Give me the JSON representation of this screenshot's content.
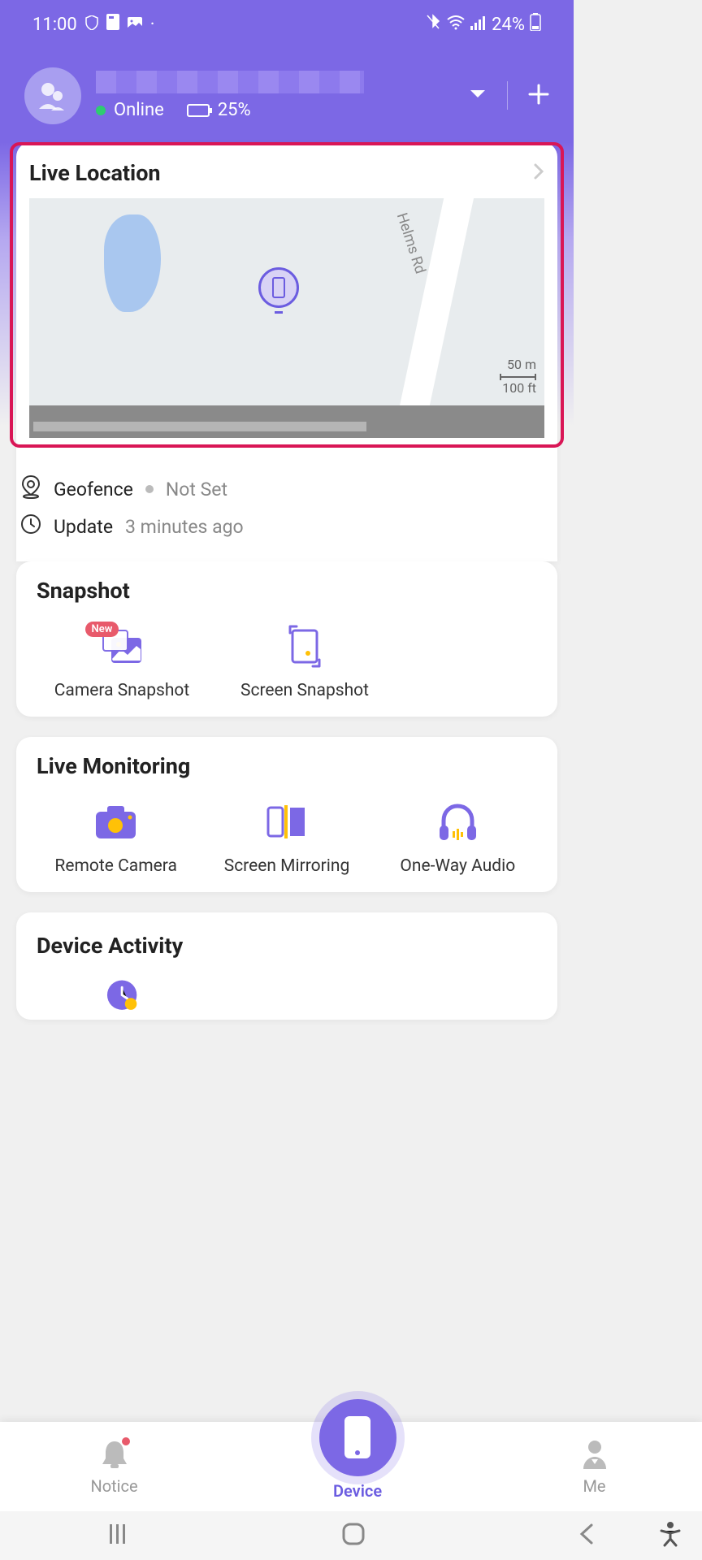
{
  "status_bar": {
    "time": "11:00",
    "battery_pct": "24%"
  },
  "header": {
    "status": "Online",
    "device_battery": "25%"
  },
  "live_location": {
    "title": "Live Location",
    "road_label": "Helms Rd",
    "scale_m": "50 m",
    "scale_ft": "100 ft",
    "geofence_label": "Geofence",
    "geofence_value": "Not Set",
    "update_label": "Update",
    "update_value": "3 minutes ago"
  },
  "snapshot": {
    "title": "Snapshot",
    "new_badge": "New",
    "camera": "Camera Snapshot",
    "screen": "Screen Snapshot"
  },
  "monitoring": {
    "title": "Live Monitoring",
    "camera": "Remote Camera",
    "mirror": "Screen Mirroring",
    "audio": "One-Way Audio"
  },
  "activity": {
    "title": "Device Activity"
  },
  "nav": {
    "notice": "Notice",
    "device": "Device",
    "me": "Me"
  }
}
